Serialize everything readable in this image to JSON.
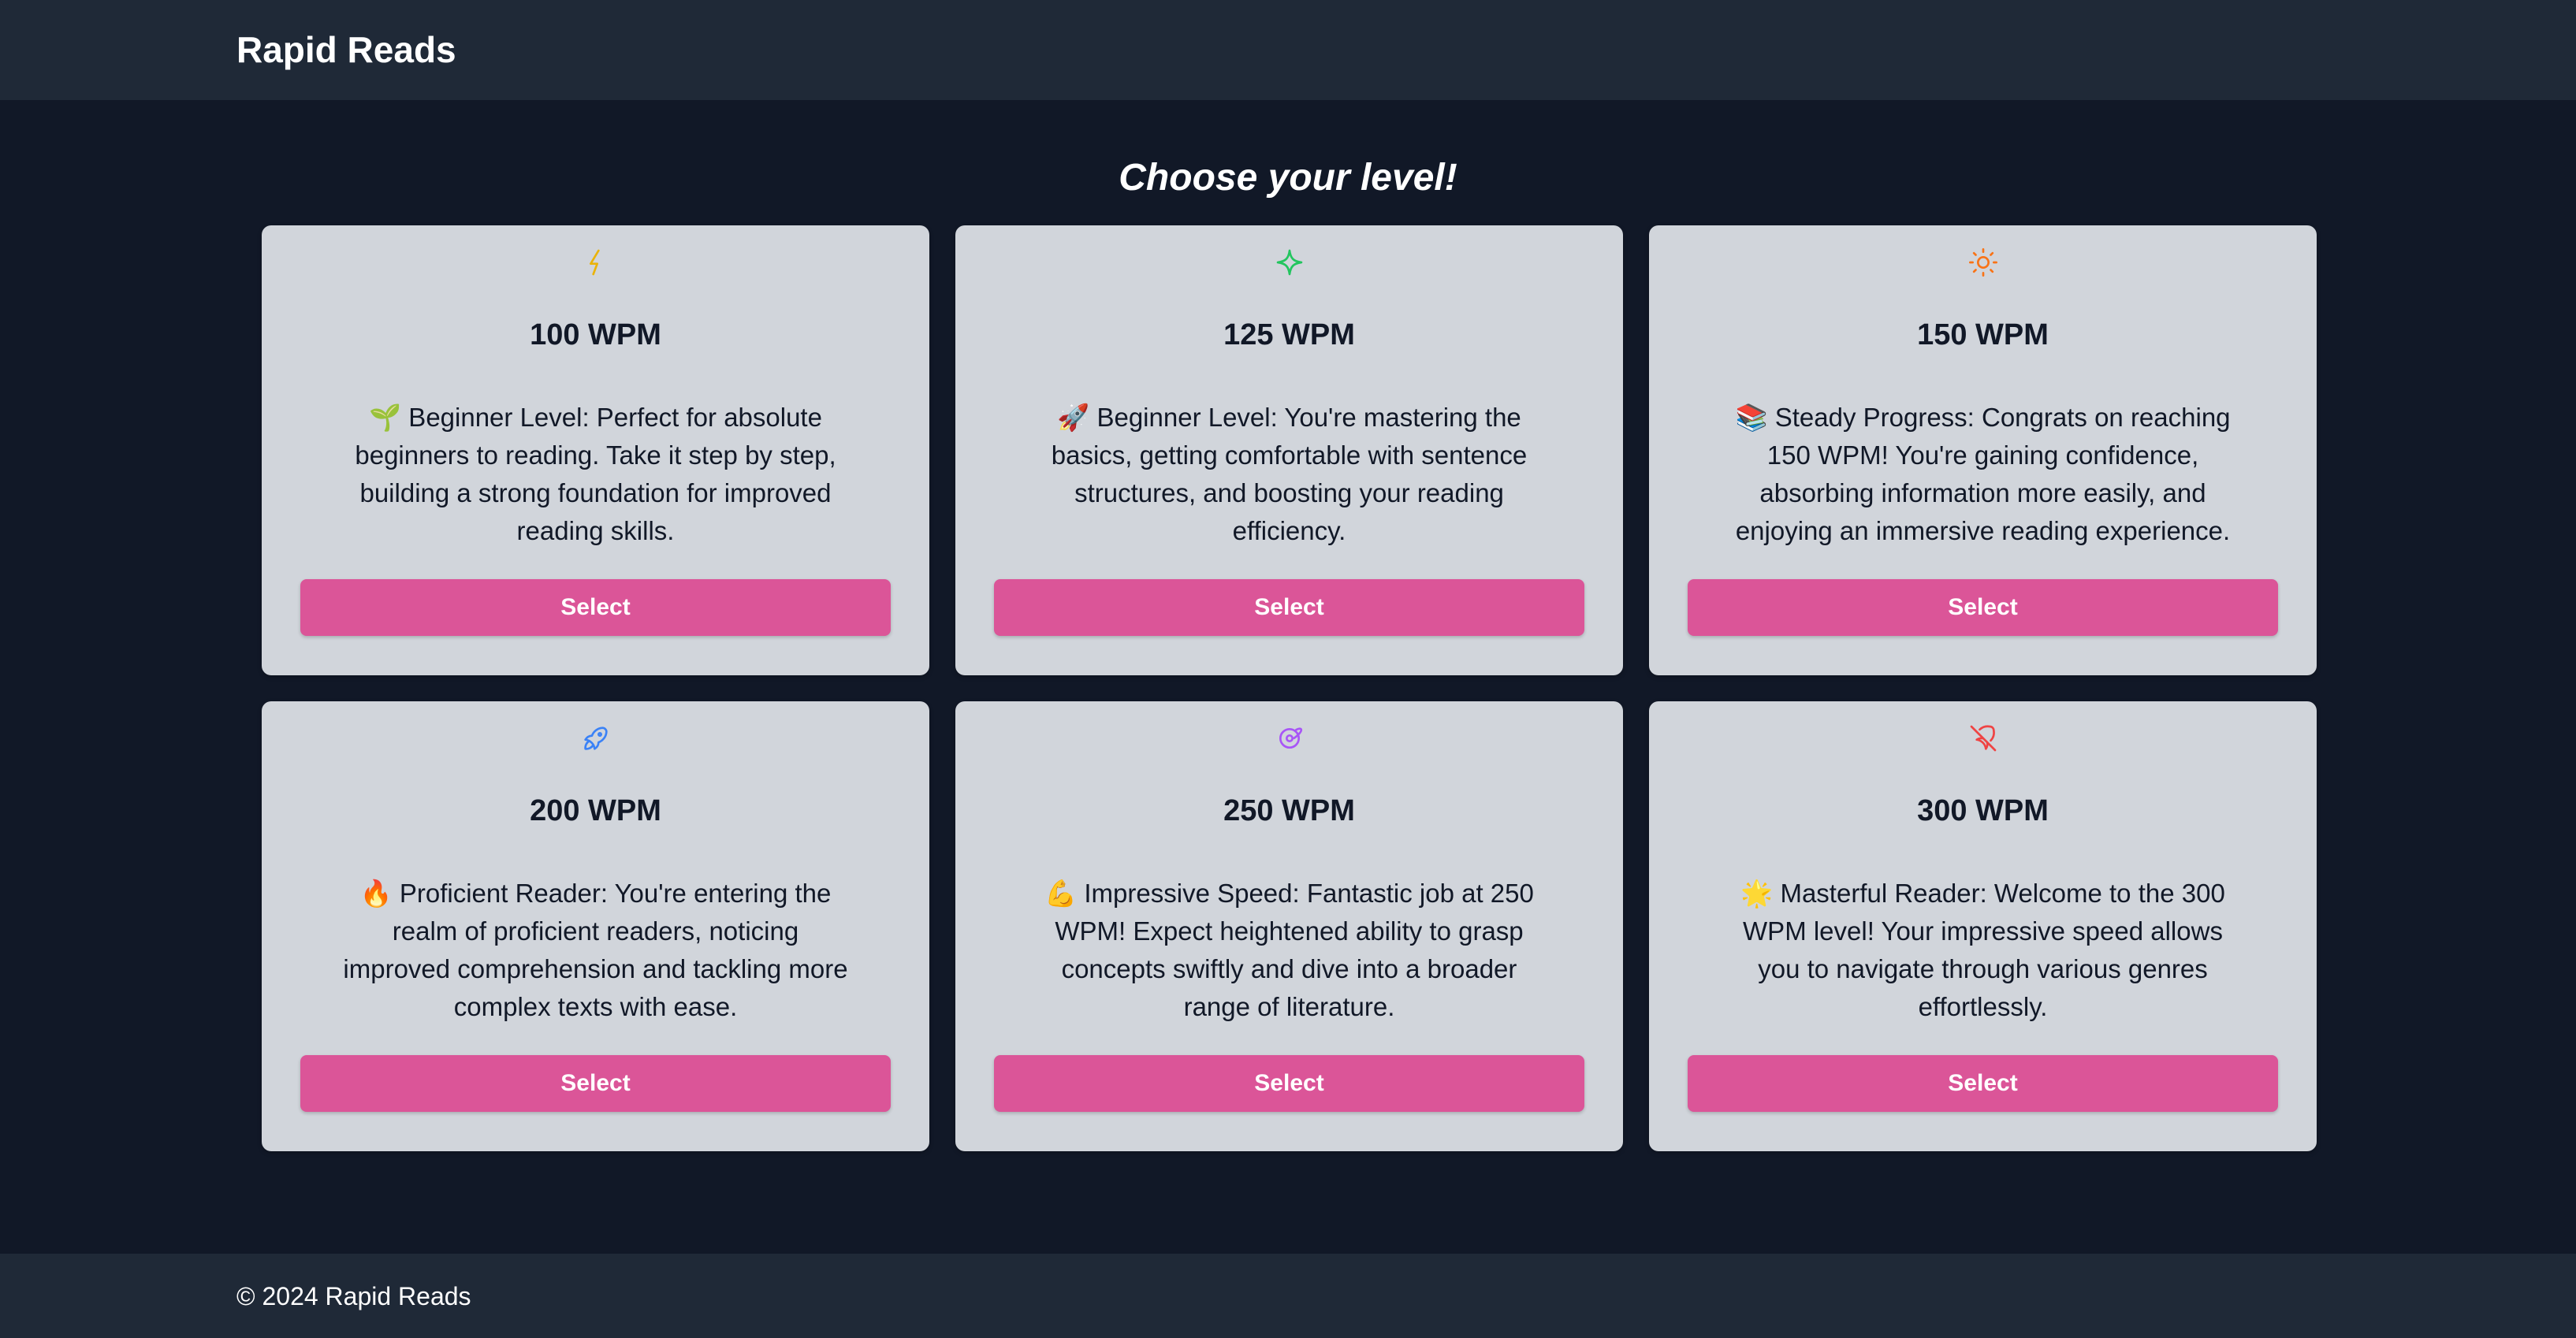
{
  "header": {
    "brand": "Rapid Reads"
  },
  "main": {
    "heading": "Choose your level!"
  },
  "levels": [
    {
      "icon": "lightning-icon",
      "icon_color": "#eab308",
      "wpm": "100 WPM",
      "description": "🌱 Beginner Level: Perfect for absolute beginners to reading. Take it step by step, building a strong foundation for improved reading skills.",
      "button": "Select"
    },
    {
      "icon": "sparkle-icon",
      "icon_color": "#22c55e",
      "wpm": "125 WPM",
      "description": "🚀 Beginner Level: You're mastering the basics, getting comfortable with sentence structures, and boosting your reading efficiency.",
      "button": "Select"
    },
    {
      "icon": "sun-icon",
      "icon_color": "#f97316",
      "wpm": "150 WPM",
      "description": "📚 Steady Progress: Congrats on reaching 150 WPM! You're gaining confidence, absorbing information more easily, and enjoying an immersive reading experience.",
      "button": "Select"
    },
    {
      "icon": "rocket-icon",
      "icon_color": "#3b82f6",
      "wpm": "200 WPM",
      "description": "🔥 Proficient Reader: You're entering the realm of proficient readers, noticing improved comprehension and tackling more complex texts with ease.",
      "button": "Select"
    },
    {
      "icon": "planet-icon",
      "icon_color": "#a855f7",
      "wpm": "250 WPM",
      "description": "💪 Impressive Speed: Fantastic job at 250 WPM! Expect heightened ability to grasp concepts swiftly and dive into a broader range of literature.",
      "button": "Select"
    },
    {
      "icon": "rocket-off-icon",
      "icon_color": "#ef4444",
      "wpm": "300 WPM",
      "description": "🌟 Masterful Reader: Welcome to the 300 WPM level! Your impressive speed allows you to navigate through various genres effortlessly.",
      "button": "Select"
    }
  ],
  "footer": {
    "copyright": "© 2024 Rapid Reads"
  }
}
